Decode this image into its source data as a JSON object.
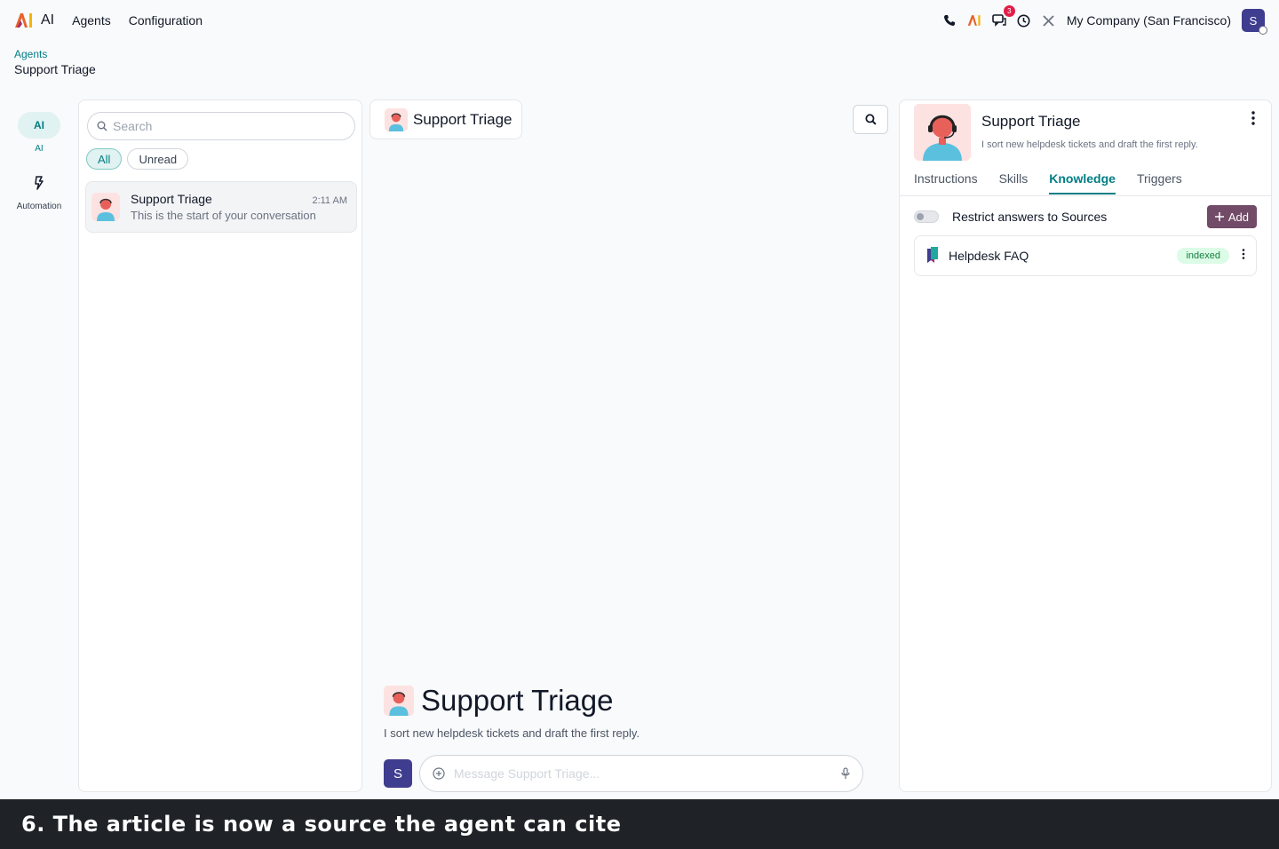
{
  "topbar": {
    "app_name": "AI",
    "nav": [
      "Agents",
      "Configuration"
    ],
    "notification_count": "3",
    "company": "My Company (San Francisco)",
    "user_initial": "S",
    "icons": [
      "phone-icon",
      "ai-logo-icon",
      "chat-icon",
      "clock-icon",
      "tools-icon"
    ]
  },
  "breadcrumb": {
    "parent": "Agents",
    "current": "Support Triage"
  },
  "rail": {
    "items": [
      {
        "label": "AI",
        "pill": "AI",
        "active": true
      },
      {
        "label": "Automation",
        "active": false
      }
    ]
  },
  "list": {
    "search_placeholder": "Search",
    "filters": [
      "All",
      "Unread"
    ],
    "conversation": {
      "name": "Support Triage",
      "time": "2:11 AM",
      "preview": "This is the start of your conversation"
    }
  },
  "chat": {
    "header_title": "Support Triage",
    "welcome_title": "Support Triage",
    "welcome_desc": "I sort new helpdesk tickets and draft the first reply.",
    "composer_placeholder": "Message Support Triage...",
    "user_initial": "S"
  },
  "agent": {
    "name": "Support Triage",
    "description": "I sort new helpdesk tickets and draft the first reply.",
    "tabs": [
      "Instructions",
      "Skills",
      "Knowledge",
      "Triggers"
    ],
    "active_tab": "Knowledge",
    "restrict_label": "Restrict answers to Sources",
    "restrict_enabled": false,
    "add_label": "Add",
    "source": {
      "name": "Helpdesk FAQ",
      "status": "indexed"
    }
  },
  "caption": "6. The article is now a source the agent can cite",
  "colors": {
    "accent": "#017e84",
    "brand": "#714b67",
    "avatar": "#3f3d8f",
    "indexed": "#15803d"
  }
}
